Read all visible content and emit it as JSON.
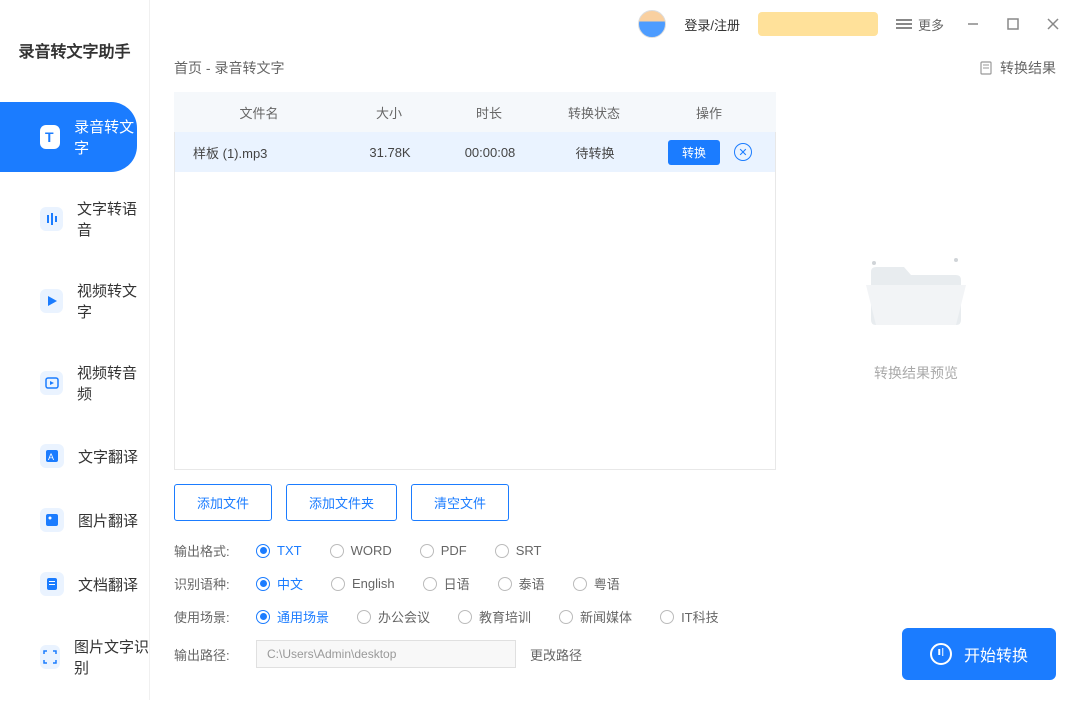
{
  "app_title": "录音转文字助手",
  "sidebar": {
    "items": [
      {
        "label": "录音转文字"
      },
      {
        "label": "文字转语音"
      },
      {
        "label": "视频转文字"
      },
      {
        "label": "视频转音频"
      },
      {
        "label": "文字翻译"
      },
      {
        "label": "图片翻译"
      },
      {
        "label": "文档翻译"
      },
      {
        "label": "图片文字识别"
      }
    ]
  },
  "titlebar": {
    "login": "登录/注册",
    "more": "更多"
  },
  "breadcrumb": "首页 - 录音转文字",
  "result_link": "转换结果",
  "table": {
    "headers": {
      "name": "文件名",
      "size": "大小",
      "duration": "时长",
      "status": "转换状态",
      "op": "操作"
    },
    "rows": [
      {
        "name": "样板 (1).mp3",
        "size": "31.78K",
        "duration": "00:00:08",
        "status": "待转换",
        "btn": "转换"
      }
    ]
  },
  "buttons": {
    "add_file": "添加文件",
    "add_folder": "添加文件夹",
    "clear": "清空文件"
  },
  "preview_text": "转换结果预览",
  "options": {
    "format_label": "输出格式:",
    "formats": [
      "TXT",
      "WORD",
      "PDF",
      "SRT"
    ],
    "lang_label": "识别语种:",
    "langs": [
      "中文",
      "English",
      "日语",
      "泰语",
      "粤语"
    ],
    "scene_label": "使用场景:",
    "scenes": [
      "通用场景",
      "办公会议",
      "教育培训",
      "新闻媒体",
      "IT科技"
    ],
    "path_label": "输出路径:",
    "path_value": "C:\\Users\\Admin\\desktop",
    "change_path": "更改路径"
  },
  "start_btn": "开始转换"
}
